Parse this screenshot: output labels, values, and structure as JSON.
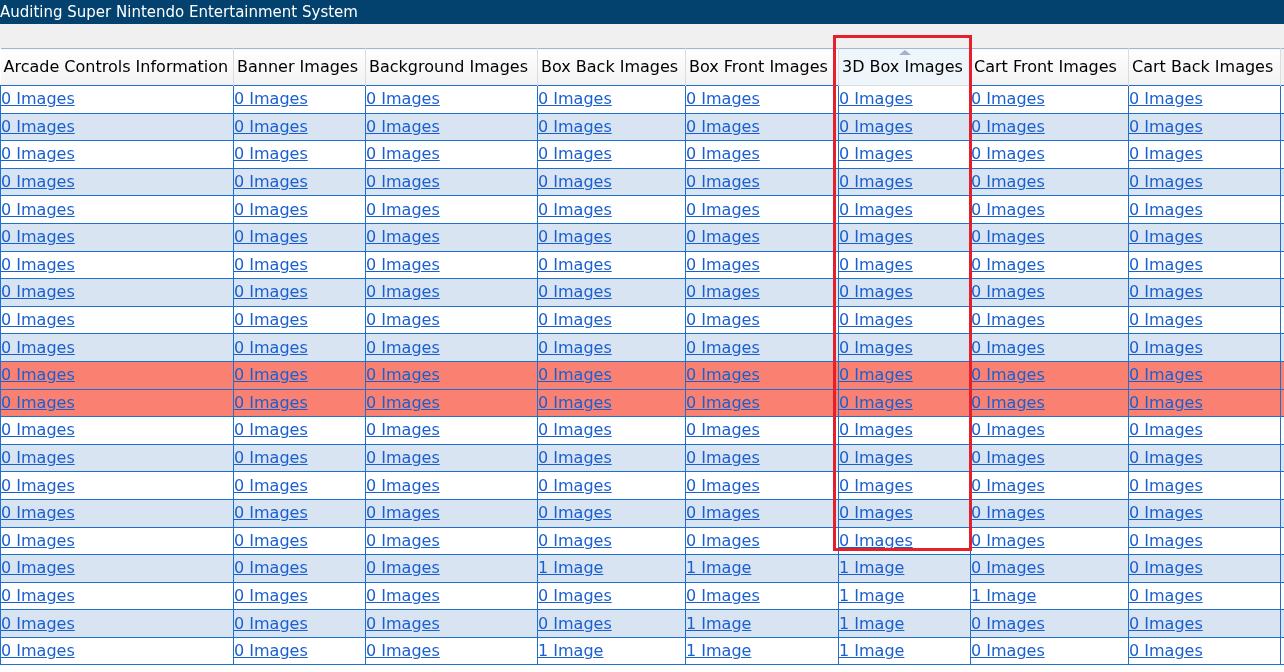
{
  "window": {
    "title": "Auditing Super Nintendo Entertainment System"
  },
  "table": {
    "columns": [
      {
        "label": "Arcade Controls Information",
        "sorted": false
      },
      {
        "label": "Banner Images",
        "sorted": false
      },
      {
        "label": "Background Images",
        "sorted": false
      },
      {
        "label": "Box Back Images",
        "sorted": false
      },
      {
        "label": "Box Front Images",
        "sorted": false
      },
      {
        "label": "3D Box Images",
        "sorted": true
      },
      {
        "label": "Cart Front Images",
        "sorted": false
      },
      {
        "label": "Cart Back Images",
        "sorted": false
      }
    ],
    "rows": [
      {
        "highlighted": false,
        "cells": [
          "0 Images",
          "0 Images",
          "0 Images",
          "0 Images",
          "0 Images",
          "0 Images",
          "0 Images",
          "0 Images"
        ]
      },
      {
        "highlighted": false,
        "cells": [
          "0 Images",
          "0 Images",
          "0 Images",
          "0 Images",
          "0 Images",
          "0 Images",
          "0 Images",
          "0 Images"
        ]
      },
      {
        "highlighted": false,
        "cells": [
          "0 Images",
          "0 Images",
          "0 Images",
          "0 Images",
          "0 Images",
          "0 Images",
          "0 Images",
          "0 Images"
        ]
      },
      {
        "highlighted": false,
        "cells": [
          "0 Images",
          "0 Images",
          "0 Images",
          "0 Images",
          "0 Images",
          "0 Images",
          "0 Images",
          "0 Images"
        ]
      },
      {
        "highlighted": false,
        "cells": [
          "0 Images",
          "0 Images",
          "0 Images",
          "0 Images",
          "0 Images",
          "0 Images",
          "0 Images",
          "0 Images"
        ]
      },
      {
        "highlighted": false,
        "cells": [
          "0 Images",
          "0 Images",
          "0 Images",
          "0 Images",
          "0 Images",
          "0 Images",
          "0 Images",
          "0 Images"
        ]
      },
      {
        "highlighted": false,
        "cells": [
          "0 Images",
          "0 Images",
          "0 Images",
          "0 Images",
          "0 Images",
          "0 Images",
          "0 Images",
          "0 Images"
        ]
      },
      {
        "highlighted": false,
        "cells": [
          "0 Images",
          "0 Images",
          "0 Images",
          "0 Images",
          "0 Images",
          "0 Images",
          "0 Images",
          "0 Images"
        ]
      },
      {
        "highlighted": false,
        "cells": [
          "0 Images",
          "0 Images",
          "0 Images",
          "0 Images",
          "0 Images",
          "0 Images",
          "0 Images",
          "0 Images"
        ]
      },
      {
        "highlighted": false,
        "cells": [
          "0 Images",
          "0 Images",
          "0 Images",
          "0 Images",
          "0 Images",
          "0 Images",
          "0 Images",
          "0 Images"
        ]
      },
      {
        "highlighted": true,
        "cells": [
          "0 Images",
          "0 Images",
          "0 Images",
          "0 Images",
          "0 Images",
          "0 Images",
          "0 Images",
          "0 Images"
        ]
      },
      {
        "highlighted": true,
        "cells": [
          "0 Images",
          "0 Images",
          "0 Images",
          "0 Images",
          "0 Images",
          "0 Images",
          "0 Images",
          "0 Images"
        ]
      },
      {
        "highlighted": false,
        "cells": [
          "0 Images",
          "0 Images",
          "0 Images",
          "0 Images",
          "0 Images",
          "0 Images",
          "0 Images",
          "0 Images"
        ]
      },
      {
        "highlighted": false,
        "cells": [
          "0 Images",
          "0 Images",
          "0 Images",
          "0 Images",
          "0 Images",
          "0 Images",
          "0 Images",
          "0 Images"
        ]
      },
      {
        "highlighted": false,
        "cells": [
          "0 Images",
          "0 Images",
          "0 Images",
          "0 Images",
          "0 Images",
          "0 Images",
          "0 Images",
          "0 Images"
        ]
      },
      {
        "highlighted": false,
        "cells": [
          "0 Images",
          "0 Images",
          "0 Images",
          "0 Images",
          "0 Images",
          "0 Images",
          "0 Images",
          "0 Images"
        ]
      },
      {
        "highlighted": false,
        "cells": [
          "0 Images",
          "0 Images",
          "0 Images",
          "0 Images",
          "0 Images",
          "0 Images",
          "0 Images",
          "0 Images"
        ]
      },
      {
        "highlighted": false,
        "cells": [
          "0 Images",
          "0 Images",
          "0 Images",
          "1 Image",
          "1 Image",
          "1 Image",
          "0 Images",
          "0 Images"
        ]
      },
      {
        "highlighted": false,
        "cells": [
          "0 Images",
          "0 Images",
          "0 Images",
          "0 Images",
          "0 Images",
          "1 Image",
          "1 Image",
          "0 Images"
        ]
      },
      {
        "highlighted": false,
        "cells": [
          "0 Images",
          "0 Images",
          "0 Images",
          "0 Images",
          "1 Image",
          "1 Image",
          "0 Images",
          "0 Images"
        ]
      },
      {
        "highlighted": false,
        "cells": [
          "0 Images",
          "0 Images",
          "0 Images",
          "1 Image",
          "1 Image",
          "1 Image",
          "0 Images",
          "0 Images"
        ]
      }
    ]
  }
}
